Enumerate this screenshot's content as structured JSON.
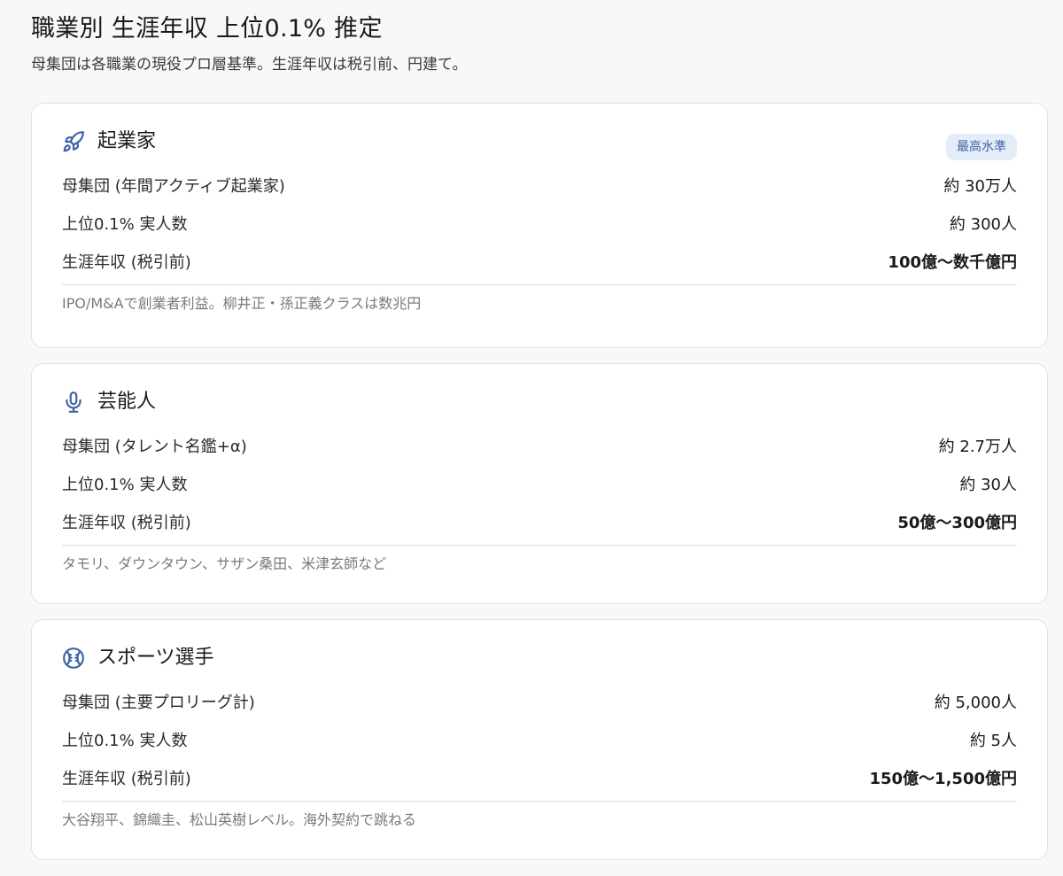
{
  "header": {
    "title": "職業別 生涯年収 上位0.1% 推定",
    "subtitle": "母集団は各職業の現役プロ層基準。生涯年収は税引前、円建て。"
  },
  "colors": {
    "accent": "#3c63a6",
    "badge_bg": "#e4ecf7",
    "card_bg": "#ffffff",
    "page_bg": "#f9f8f6"
  },
  "cards": [
    {
      "icon": "rocket-icon",
      "title": "起業家",
      "badge": "最高水準",
      "rows": [
        {
          "label": "母集団 (年間アクティブ起業家)",
          "value": "約 30万人"
        },
        {
          "label": "上位0.1% 実人数",
          "value": "約 300人"
        },
        {
          "label": "生涯年収 (税引前)",
          "value": "100億〜数千億円"
        }
      ],
      "note": "IPO/M&Aで創業者利益。柳井正・孫正義クラスは数兆円"
    },
    {
      "icon": "microphone-icon",
      "title": "芸能人",
      "rows": [
        {
          "label": "母集団 (タレント名鑑+α)",
          "value": "約 2.7万人"
        },
        {
          "label": "上位0.1% 実人数",
          "value": "約 30人"
        },
        {
          "label": "生涯年収 (税引前)",
          "value": "50億〜300億円"
        }
      ],
      "note": "タモリ、ダウンタウン、サザン桑田、米津玄師など"
    },
    {
      "icon": "baseball-icon",
      "title": "スポーツ選手",
      "rows": [
        {
          "label": "母集団 (主要プロリーグ計)",
          "value": "約 5,000人"
        },
        {
          "label": "上位0.1% 実人数",
          "value": "約 5人"
        },
        {
          "label": "生涯年収 (税引前)",
          "value": "150億〜1,500億円"
        }
      ],
      "note": "大谷翔平、錦織圭、松山英樹レベル。海外契約で跳ねる"
    }
  ]
}
